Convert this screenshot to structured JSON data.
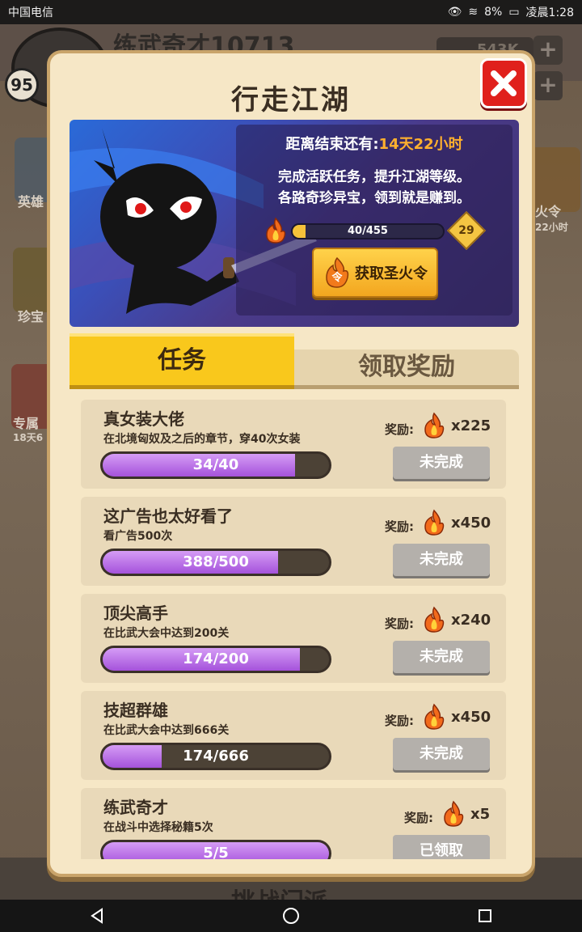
{
  "status_bar": {
    "carrier": "中国电信",
    "battery": "8%",
    "time": "凌晨1:28"
  },
  "background": {
    "player_name": "练武奇才10713",
    "level": "95",
    "coins": "543K",
    "side_left": [
      "英雄",
      "珍宝",
      "专属",
      "18天6"
    ],
    "side_right": [
      "火令",
      "22小时"
    ],
    "bottom_tabs": [
      "挑战门派"
    ]
  },
  "dialog": {
    "title": "行走江湖",
    "banner": {
      "countdown_label": "距离结束还有:",
      "countdown_value": "14天22小时",
      "desc_line1": "完成活跃任务，提升江湖等级。",
      "desc_line2": "各路奇珍异宝，领到就是赚到。",
      "xp_text": "40/455",
      "xp_current": 40,
      "xp_max": 455,
      "level": "29",
      "button_label": "获取圣火令",
      "button_icon_text": "令"
    },
    "tabs": {
      "active": "任务",
      "inactive": "领取奖励"
    },
    "reward_label": "奖励:",
    "tasks": [
      {
        "title": "真女装大佬",
        "desc": "在北境匈奴及之后的章节，穿40次女装",
        "progress_text": "34/40",
        "current": 34,
        "total": 40,
        "reward": "x225",
        "status": "未完成"
      },
      {
        "title": "这广告也太好看了",
        "desc": "看广告500次",
        "progress_text": "388/500",
        "current": 388,
        "total": 500,
        "reward": "x450",
        "status": "未完成"
      },
      {
        "title": "顶尖高手",
        "desc": "在比武大会中达到200关",
        "progress_text": "174/200",
        "current": 174,
        "total": 200,
        "reward": "x240",
        "status": "未完成"
      },
      {
        "title": "技超群雄",
        "desc": "在比武大会中达到666关",
        "progress_text": "174/666",
        "current": 174,
        "total": 666,
        "reward": "x450",
        "status": "未完成"
      },
      {
        "title": "练武奇才",
        "desc": "在战斗中选择秘籍5次",
        "progress_text": "5/5",
        "current": 5,
        "total": 5,
        "reward": "x5",
        "status": "已领取"
      }
    ]
  },
  "colors": {
    "accent": "#f9c81c",
    "progress": "#b566e0",
    "close": "#e0201c",
    "countdown": "#ffb02e"
  },
  "icons": {
    "close": "close-x-icon",
    "fire": "fire-token-icon",
    "back": "back-icon",
    "home": "home-icon",
    "recents": "recents-icon"
  }
}
